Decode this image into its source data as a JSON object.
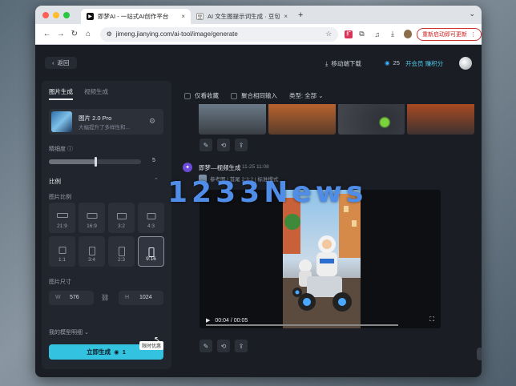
{
  "browser": {
    "tabs": [
      {
        "title": "即梦AI - 一站式AI创作平台",
        "favicon_color": "#111111",
        "active": true
      },
      {
        "title": "AI 文生图提示词生成 · 豆包",
        "favicon_color": "#ffffff",
        "active": false
      }
    ],
    "new_tab_symbol": "+",
    "url": "jimeng.jianying.com/ai-tool/image/generate",
    "update_button": "重新启动即可更新",
    "traffic_colors": [
      "#ff5f57",
      "#febc2e",
      "#28c840"
    ]
  },
  "header": {
    "back_label": "返回",
    "download_label": "移动端下载",
    "credits": "25",
    "vip_label": "开会员 赚积分"
  },
  "left_panel": {
    "tabs": [
      "图片生成",
      "视频生成"
    ],
    "model": {
      "name": "图片 2.0 Pro",
      "desc": "大幅提升了多样性和..."
    },
    "fineness_label": "精细度",
    "fineness_value": "5",
    "fineness_fraction": 0.5,
    "ratio_section": "比例",
    "ratio_label": "图片比例",
    "ratios": [
      {
        "label": "21:9",
        "w": 14,
        "h": 6,
        "selected": false
      },
      {
        "label": "16:9",
        "w": 13,
        "h": 7,
        "selected": false
      },
      {
        "label": "3:2",
        "w": 12,
        "h": 8,
        "selected": false
      },
      {
        "label": "4:3",
        "w": 11,
        "h": 8,
        "selected": false
      },
      {
        "label": "1:1",
        "w": 9,
        "h": 9,
        "selected": false
      },
      {
        "label": "3:4",
        "w": 8,
        "h": 11,
        "selected": false
      },
      {
        "label": "2:3",
        "w": 8,
        "h": 12,
        "selected": false
      },
      {
        "label": "9:16",
        "w": 7,
        "h": 12,
        "selected": true
      }
    ],
    "size_label": "图片尺寸",
    "width_key": "W",
    "width_value": "576",
    "height_key": "H",
    "height_value": "1024",
    "advanced_label": "我的模型明细",
    "generate_label": "立即生成",
    "generate_cost": "1",
    "tooltip": "限时优惠"
  },
  "filters": {
    "favorites": "仅看收藏",
    "merge": "聚合相同输入",
    "type": "类型: 全部"
  },
  "generation": {
    "title": "即梦—视频生成",
    "time": "11-25 11:08",
    "ref_text": "参考图 | 首尾 2:3:2 | 标准模式"
  },
  "video": {
    "current": "00:04",
    "total": "00:05",
    "played_fraction": 1.0
  },
  "watermark": "1233News"
}
